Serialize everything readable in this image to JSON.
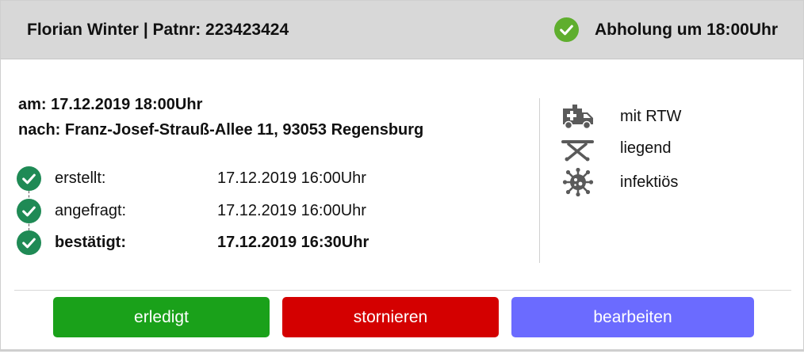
{
  "header": {
    "patient": "Florian Winter | Patnr: 223423424",
    "status_icon": "check-circle-icon",
    "status": "Abholung um 18:00Uhr"
  },
  "trip": {
    "date_line": "am: 17.12.2019 18:00Uhr",
    "destination_line": "nach: Franz-Josef-Strauß-Allee 11, 93053 Regensburg"
  },
  "timeline": [
    {
      "label": "erstellt:",
      "value": "17.12.2019 16:00Uhr",
      "bold": false
    },
    {
      "label": "angefragt:",
      "value": "17.12.2019 16:00Uhr",
      "bold": false
    },
    {
      "label": "bestätigt:",
      "value": "17.12.2019 16:30Uhr",
      "bold": true
    }
  ],
  "features": [
    {
      "icon": "ambulance-icon",
      "label": "mit RTW"
    },
    {
      "icon": "stretcher-icon",
      "label": "liegend"
    },
    {
      "icon": "virus-icon",
      "label": "infektiös"
    }
  ],
  "buttons": {
    "done": "erledigt",
    "cancel": "stornieren",
    "edit": "bearbeiten"
  },
  "colors": {
    "check": "#1f8a55",
    "header_bg": "#d8d8d8",
    "icon_gray": "#5a5a5a",
    "done": "#1aa11a",
    "cancel": "#d40000",
    "edit": "#6b6bff"
  }
}
